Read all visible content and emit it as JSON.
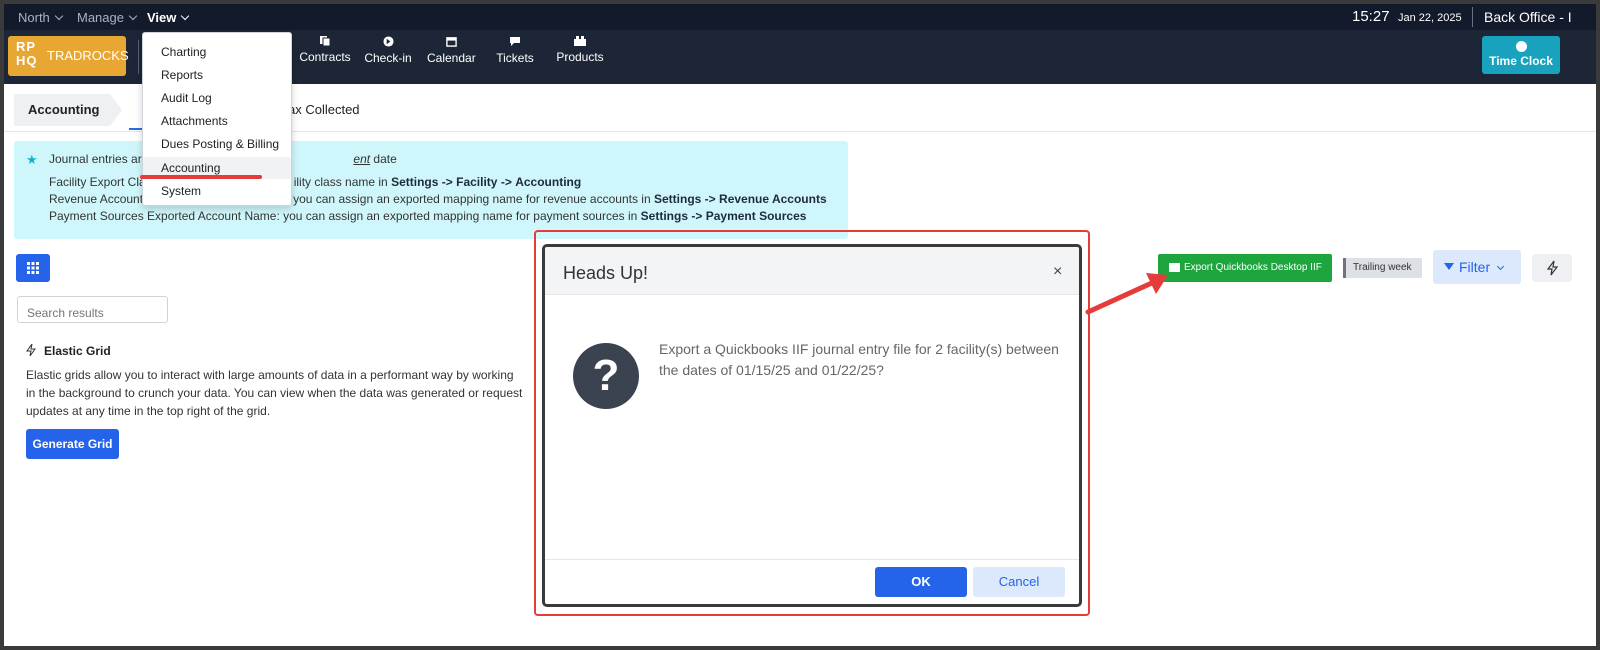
{
  "topbar": {
    "menus": [
      "North",
      "Manage",
      "View"
    ],
    "time": "15:27",
    "date": "Jan 22, 2025",
    "back_office": "Back Office - I"
  },
  "nav": {
    "logo_letters": "RP HQ",
    "logo_name": "TRADROCKS",
    "items": [
      "Contracts",
      "Check-in",
      "Calendar",
      "Tickets",
      "Products"
    ],
    "time_clock": "Time Clock"
  },
  "view_menu": {
    "items": [
      "Charting",
      "Reports",
      "Audit Log",
      "Attachments",
      "Dues Posting & Billing",
      "Accounting",
      "System"
    ],
    "highlighted": "Accounting"
  },
  "page": {
    "breadcrumb": "Accounting",
    "tab_partial": "ax Collected"
  },
  "info": {
    "line1_a": "Journal entries are",
    "line1_b": "ent",
    "line1_c": "date",
    "line2_a": "Facility Export Clas",
    "line2_b": "ility class name in",
    "line2_s1": "Settings",
    "line2_s2": "Facility",
    "line2_s3": "Accounting",
    "line3_a": "Revenue Account",
    "line3_b": "you can assign an exported mapping name for revenue accounts in",
    "line3_s1": "Settings",
    "line3_s2": "Revenue Accounts",
    "line4_a": "Payment Sources Exported Account Name: you can assign an exported mapping name for payment sources in",
    "line4_s1": "Settings",
    "line4_s2": "Payment Sources",
    "arrow": "->"
  },
  "grid": {
    "search_placeholder": "Search results",
    "title": "Elastic Grid",
    "description": "Elastic grids allow you to interact with large amounts of data in a performant way by working in the background to crunch your data. You can view when the data was generated or request updates at any time in the top right of the grid.",
    "generate_label": "Generate Grid"
  },
  "toolbar": {
    "export_label": "Export Quickbooks Desktop IIF",
    "trailing_label": "Trailing week",
    "filter_label": "Filter"
  },
  "modal": {
    "title": "Heads Up!",
    "close": "×",
    "icon_glyph": "?",
    "message": "Export a Quickbooks IIF journal entry file for 2 facility(s) between the dates of 01/15/25 and 01/22/25?",
    "ok_label": "OK",
    "cancel_label": "Cancel"
  },
  "colors": {
    "accent": "#2563eb",
    "export_green": "#1ea63e",
    "annotation_red": "#e53b3b",
    "info_bg": "#cff7fb",
    "logo": "#e8a732"
  }
}
